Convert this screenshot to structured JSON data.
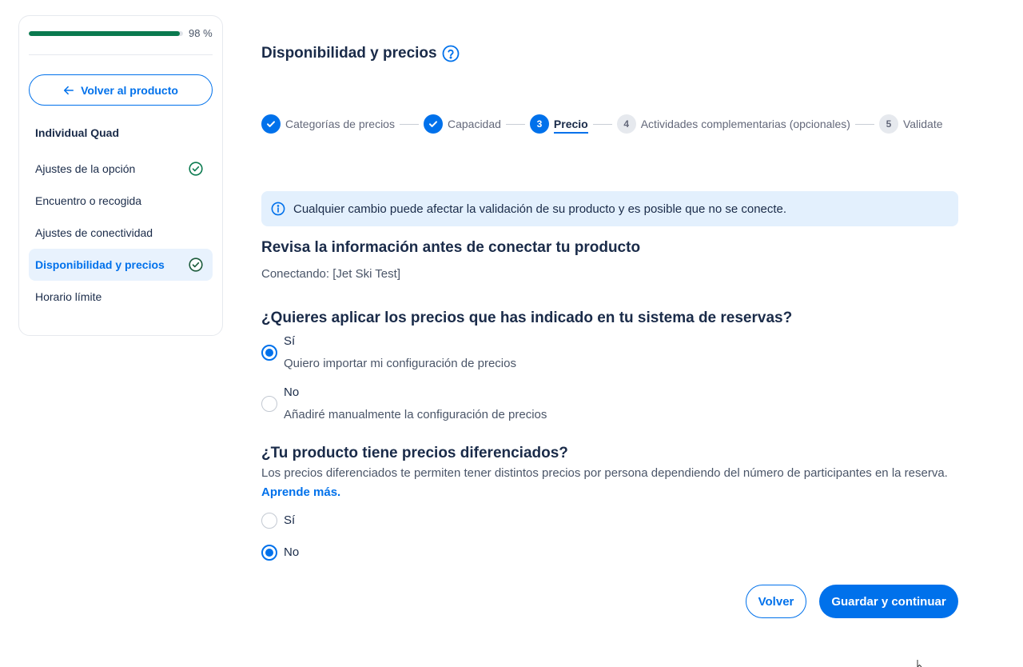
{
  "sidebar": {
    "progress_percent": 98,
    "progress_label": "98 %",
    "back_label": "Volver al producto",
    "product_title": "Individual Quad",
    "items": [
      {
        "label": "Ajustes de la opción",
        "completed": true,
        "active": false
      },
      {
        "label": "Encuentro o recogida",
        "completed": false,
        "active": false
      },
      {
        "label": "Ajustes de conectividad",
        "completed": false,
        "active": false
      },
      {
        "label": "Disponibilidad y precios",
        "completed": true,
        "active": true
      },
      {
        "label": "Horario límite",
        "completed": false,
        "active": false
      }
    ]
  },
  "header": {
    "title": "Disponibilidad y precios"
  },
  "stepper": {
    "steps": [
      {
        "number": "",
        "label": "Categorías de precios",
        "state": "done"
      },
      {
        "number": "",
        "label": "Capacidad",
        "state": "done"
      },
      {
        "number": "3",
        "label": "Precio",
        "state": "current"
      },
      {
        "number": "4",
        "label": "Actividades complementarias (opcionales)",
        "state": "todo"
      },
      {
        "number": "5",
        "label": "Validate",
        "state": "todo"
      }
    ]
  },
  "banner": {
    "text": "Cualquier cambio puede afectar la validación de su producto y es posible que no se conecte."
  },
  "review": {
    "heading": "Revisa la información antes de conectar tu producto",
    "connecting": "Conectando: [Jet Ski Test]"
  },
  "question1": {
    "heading": "¿Quieres aplicar los precios que has indicado en tu sistema de reservas?",
    "options": [
      {
        "label": "Sí",
        "sub": "Quiero importar mi configuración de precios",
        "checked": true
      },
      {
        "label": "No",
        "sub": "Añadiré manualmente la configuración de precios",
        "checked": false
      }
    ]
  },
  "question2": {
    "heading": "¿Tu producto tiene precios diferenciados?",
    "description": "Los precios diferenciados te permiten tener distintos precios por persona dependiendo del número de participantes en la reserva.",
    "learn_more": "Aprende más.",
    "options": [
      {
        "label": "Sí",
        "checked": false
      },
      {
        "label": "No",
        "checked": true
      }
    ]
  },
  "footer": {
    "back_label": "Volver",
    "save_label": "Guardar y continuar"
  },
  "colors": {
    "accent": "#0071eb",
    "progress": "#0a7a4f",
    "success": "#0a7a4f"
  }
}
